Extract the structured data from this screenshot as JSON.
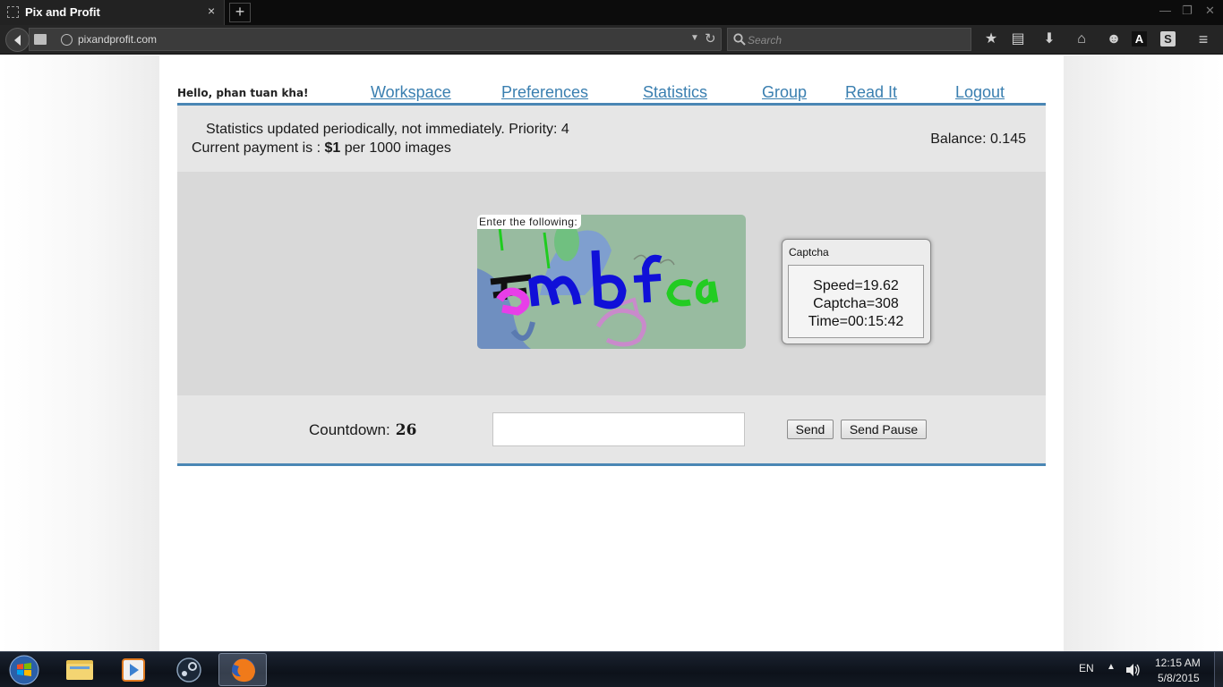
{
  "browser": {
    "tab_title": "Pix and Profit",
    "tab_close": "×",
    "new_tab": "+",
    "url": "pixandprofit.com",
    "search_placeholder": "Search",
    "window_controls": [
      "—",
      "❐",
      "✕"
    ]
  },
  "header": {
    "greeting": "Hello, phan tuan kha!",
    "nav": [
      "Workspace",
      "Preferences",
      "Statistics",
      "Group",
      "Read It",
      "Logout"
    ]
  },
  "info": {
    "line1": "Statistics updated periodically, not immediately. Priority: 4",
    "payment_prefix": "Current payment is : ",
    "payment_amount": "$1",
    "payment_suffix": " per 1000 images",
    "balance": "Balance: 0.145"
  },
  "captcha": {
    "label": "Enter the following:",
    "image_colors": {
      "background": "#98bba0",
      "text_blue": "#1010d8",
      "text_black": "#111111",
      "text_magenta": "#e83ee8",
      "text_green": "#22cc22"
    }
  },
  "widget": {
    "title": "Captcha",
    "speed": "Speed=19.62",
    "captcha": "Captcha=308",
    "time": "Time=00:15:42"
  },
  "controls": {
    "countdown_label": "Countdown:",
    "countdown_value": "26",
    "answer_value": "",
    "send_label": "Send",
    "send_pause_label": "Send Pause"
  },
  "taskbar": {
    "apps": [
      "file-explorer",
      "media-player",
      "steam",
      "firefox"
    ],
    "language": "EN",
    "time": "12:15 AM",
    "date": "5/8/2015"
  },
  "colors": {
    "accent": "#4a86b4",
    "link": "#3a7fb0"
  }
}
